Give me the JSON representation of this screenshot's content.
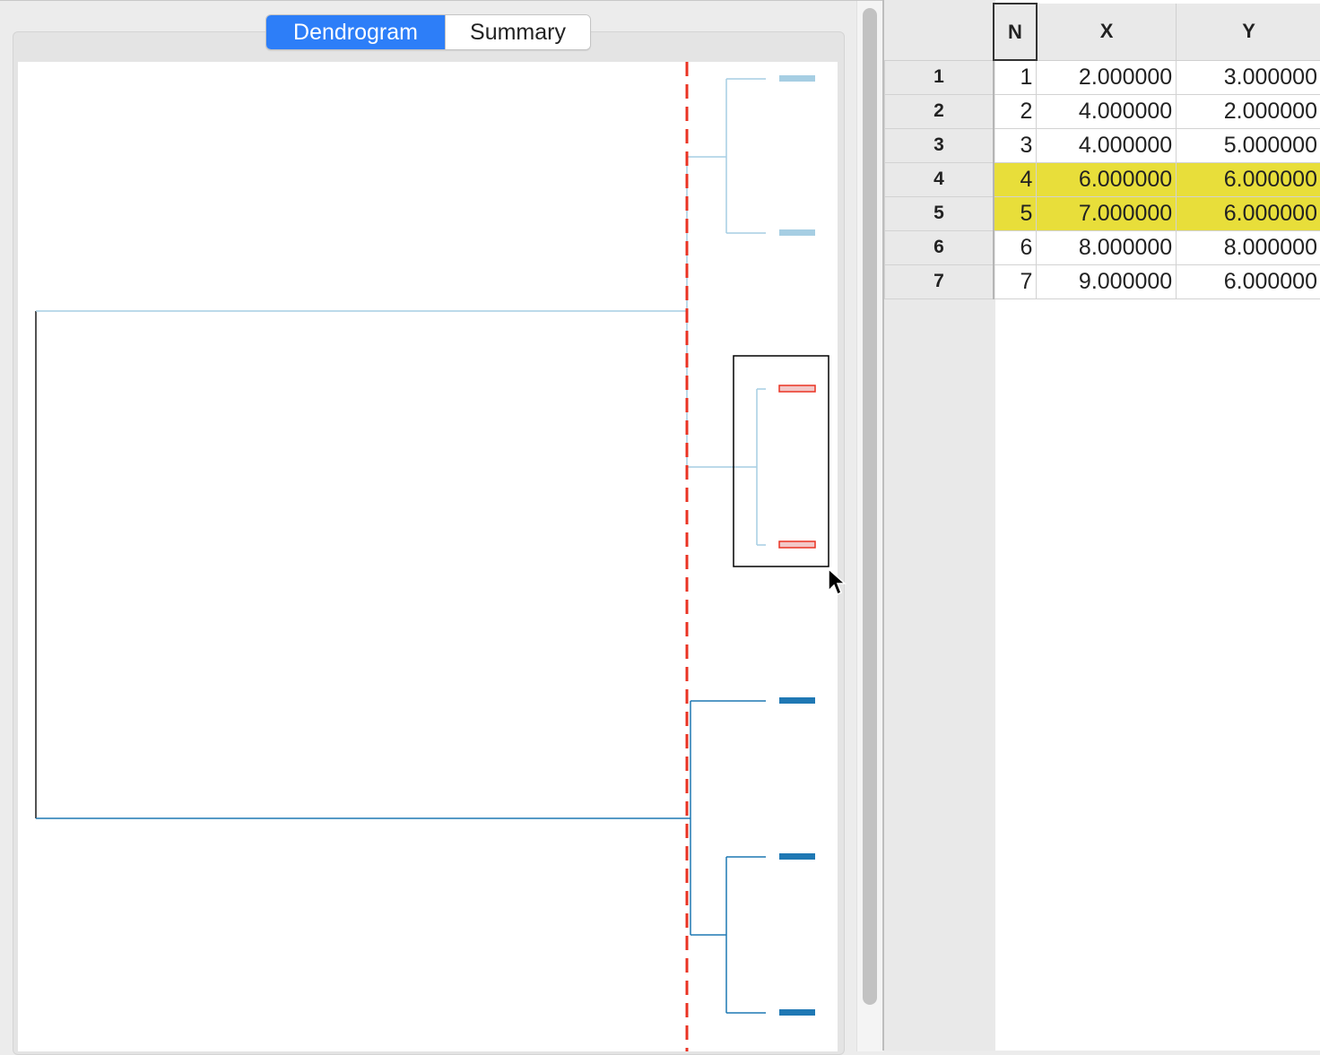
{
  "tabs": {
    "dendrogram": "Dendrogram",
    "summary": "Summary",
    "active": "Dendrogram"
  },
  "dendrogram": {
    "cut_line_color": "#ea3323",
    "cluster_colors": [
      "#a6cee3",
      "#a6cee3",
      "#1f78b4"
    ],
    "highlight_color": "#ea3323",
    "leaves": [
      {
        "cluster": 0,
        "highlighted": false
      },
      {
        "cluster": 0,
        "highlighted": false
      },
      {
        "cluster": 1,
        "highlighted": true
      },
      {
        "cluster": 1,
        "highlighted": true
      },
      {
        "cluster": 2,
        "highlighted": false
      },
      {
        "cluster": 2,
        "highlighted": false
      },
      {
        "cluster": 2,
        "highlighted": false
      }
    ]
  },
  "table": {
    "headers": [
      "N",
      "X",
      "Y"
    ],
    "rows": [
      {
        "label": "1",
        "n": "1",
        "x": "2.000000",
        "y": "3.000000",
        "highlighted": false
      },
      {
        "label": "2",
        "n": "2",
        "x": "4.000000",
        "y": "2.000000",
        "highlighted": false
      },
      {
        "label": "3",
        "n": "3",
        "x": "4.000000",
        "y": "5.000000",
        "highlighted": false
      },
      {
        "label": "4",
        "n": "4",
        "x": "6.000000",
        "y": "6.000000",
        "highlighted": true
      },
      {
        "label": "5",
        "n": "5",
        "x": "7.000000",
        "y": "6.000000",
        "highlighted": true
      },
      {
        "label": "6",
        "n": "6",
        "x": "8.000000",
        "y": "8.000000",
        "highlighted": false
      },
      {
        "label": "7",
        "n": "7",
        "x": "9.000000",
        "y": "6.000000",
        "highlighted": false
      }
    ],
    "highlight_color": "#e8de3a"
  }
}
